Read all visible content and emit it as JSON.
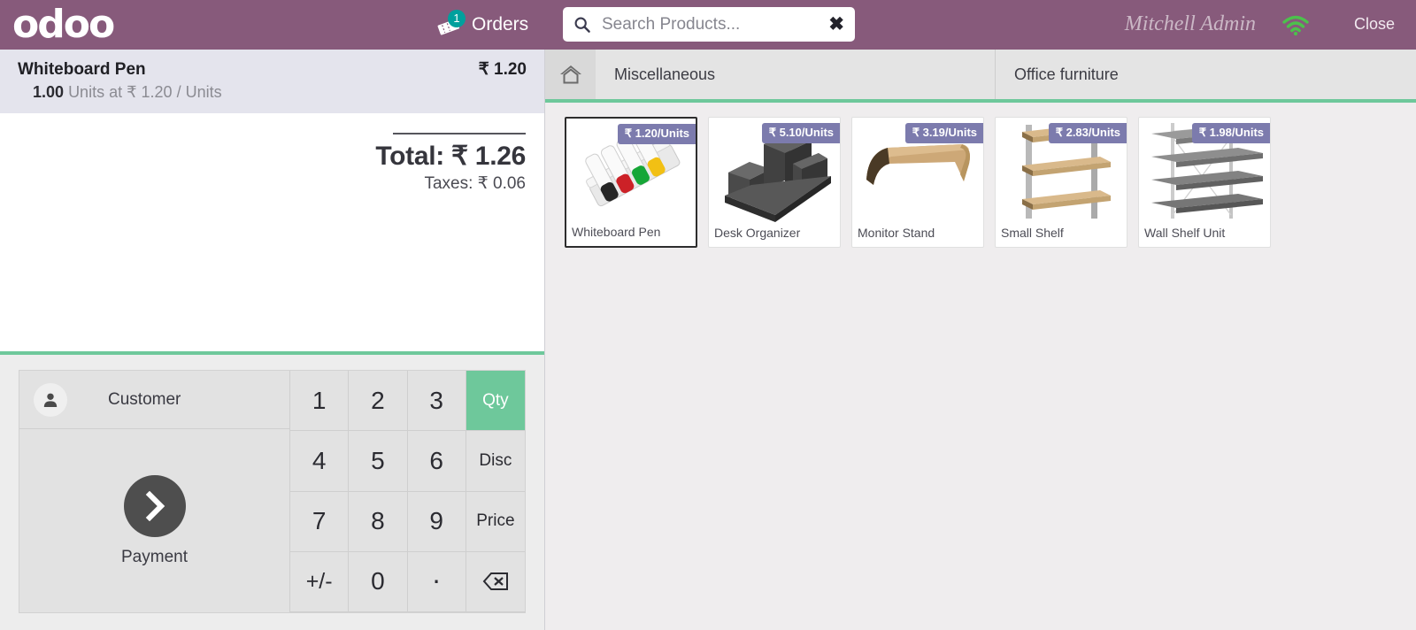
{
  "topbar": {
    "logo": "odoo",
    "orders_label": "Orders",
    "orders_badge": "1",
    "orders_icon": "ticket-icon",
    "search_placeholder": "Search Products...",
    "search_value": "",
    "search_icon": "search-icon",
    "clear_icon": "close-icon",
    "user": "Mitchell Admin",
    "wifi_icon": "wifi-icon",
    "close": "Close",
    "brand_color": "#875A7B",
    "badge_color": "#00A09D"
  },
  "order": {
    "lines": [
      {
        "name": "Whiteboard Pen",
        "price": "₹ 1.20",
        "qty": "1.00",
        "detail": "Units at ₹ 1.20 / Units"
      }
    ],
    "total_label": "Total: ₹ 1.26",
    "taxes_label": "Taxes: ₹ 0.06"
  },
  "numpad": {
    "customer_label": "Customer",
    "customer_icon": "user-icon",
    "payment_label": "Payment",
    "payment_icon": "chevron-right-icon",
    "keys": [
      {
        "label": "1",
        "kind": "digit",
        "active": false
      },
      {
        "label": "2",
        "kind": "digit",
        "active": false
      },
      {
        "label": "3",
        "kind": "digit",
        "active": false
      },
      {
        "label": "Qty",
        "kind": "mode",
        "active": true
      },
      {
        "label": "4",
        "kind": "digit",
        "active": false
      },
      {
        "label": "5",
        "kind": "digit",
        "active": false
      },
      {
        "label": "6",
        "kind": "digit",
        "active": false
      },
      {
        "label": "Disc",
        "kind": "mode",
        "active": false
      },
      {
        "label": "7",
        "kind": "digit",
        "active": false
      },
      {
        "label": "8",
        "kind": "digit",
        "active": false
      },
      {
        "label": "9",
        "kind": "digit",
        "active": false
      },
      {
        "label": "Price",
        "kind": "mode",
        "active": false
      },
      {
        "label": "+/-",
        "kind": "sign",
        "active": false
      },
      {
        "label": "0",
        "kind": "digit",
        "active": false
      },
      {
        "label": ".",
        "kind": "dot",
        "active": false
      },
      {
        "label": "backspace-icon",
        "kind": "backspace",
        "active": false
      }
    ],
    "accent_color": "#6EC89B"
  },
  "categories": {
    "home_icon": "home-icon",
    "items": [
      {
        "label": "Miscellaneous"
      },
      {
        "label": "Office furniture"
      }
    ]
  },
  "products": [
    {
      "name": "Whiteboard Pen",
      "price": "₹ 1.20/Units",
      "image": "whiteboard-pen-image",
      "selected": true
    },
    {
      "name": "Desk Organizer",
      "price": "₹ 5.10/Units",
      "image": "desk-organizer-image",
      "selected": false
    },
    {
      "name": "Monitor Stand",
      "price": "₹ 3.19/Units",
      "image": "monitor-stand-image",
      "selected": false
    },
    {
      "name": "Small Shelf",
      "price": "₹ 2.83/Units",
      "image": "small-shelf-image",
      "selected": false
    },
    {
      "name": "Wall Shelf Unit",
      "price": "₹ 1.98/Units",
      "image": "wall-shelf-unit-image",
      "selected": false
    }
  ]
}
